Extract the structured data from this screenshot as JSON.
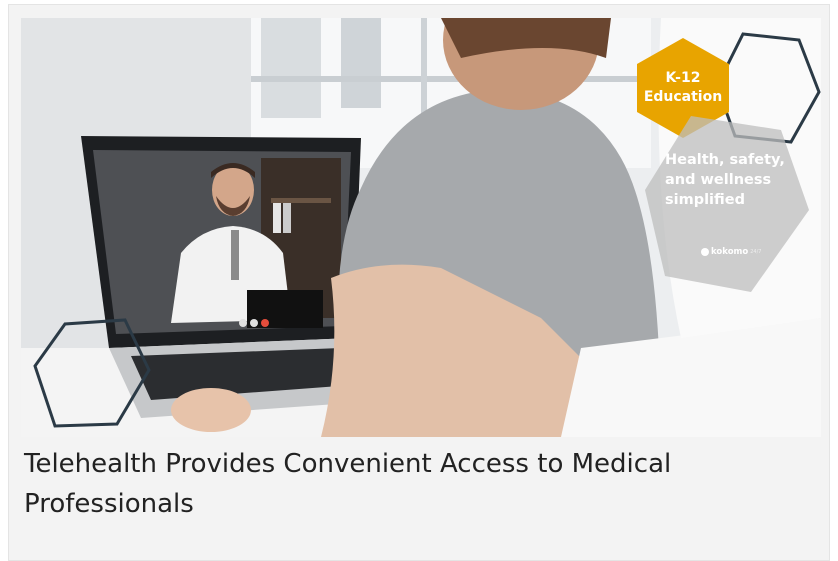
{
  "card": {
    "image_alt": "Child on a video call with a doctor on a laptop",
    "badge": {
      "line1": "K-12",
      "line2": "Education",
      "color": "#e8a400"
    },
    "overlay": {
      "line1": "Health, safety,",
      "line2": "and wellness",
      "line3": "simplified",
      "brand": "kokomo",
      "brand_suffix": "24/7"
    },
    "accent_hexagon_color": "#2b3a46",
    "caption": "Telehealth Provides Convenient Access to Medical Professionals"
  }
}
